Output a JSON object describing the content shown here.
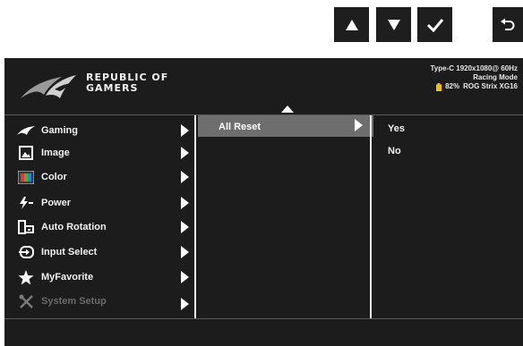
{
  "nav_keys": {
    "up_icon": "up-arrow-icon",
    "down_icon": "down-arrow-icon",
    "confirm_icon": "checkmark-icon",
    "back_icon": "back-return-icon"
  },
  "header": {
    "brand_line1": "REPUBLIC OF",
    "brand_line2": "GAMERS",
    "input_status": "Type-C  1920x1080@  60Hz",
    "mode": "Racing Mode",
    "battery": "82%",
    "model": "ROG Strix XG16",
    "battery_color": "#f2c200"
  },
  "main_menu": {
    "items": [
      {
        "label": "Gaming",
        "icon": "rog-eye-icon"
      },
      {
        "label": "Image",
        "icon": "image-icon"
      },
      {
        "label": "Color",
        "icon": "color-palette-icon"
      },
      {
        "label": "Power",
        "icon": "power-plug-icon"
      },
      {
        "label": "Auto Rotation",
        "icon": "auto-rotation-icon"
      },
      {
        "label": "Input Select",
        "icon": "input-select-icon"
      },
      {
        "label": "MyFavorite",
        "icon": "star-icon"
      },
      {
        "label": "System Setup",
        "icon": "wrench-screwdriver-icon",
        "disabled": true
      }
    ]
  },
  "sub_menu": {
    "selected": "All Reset"
  },
  "options": {
    "items": [
      "Yes",
      "No"
    ]
  }
}
